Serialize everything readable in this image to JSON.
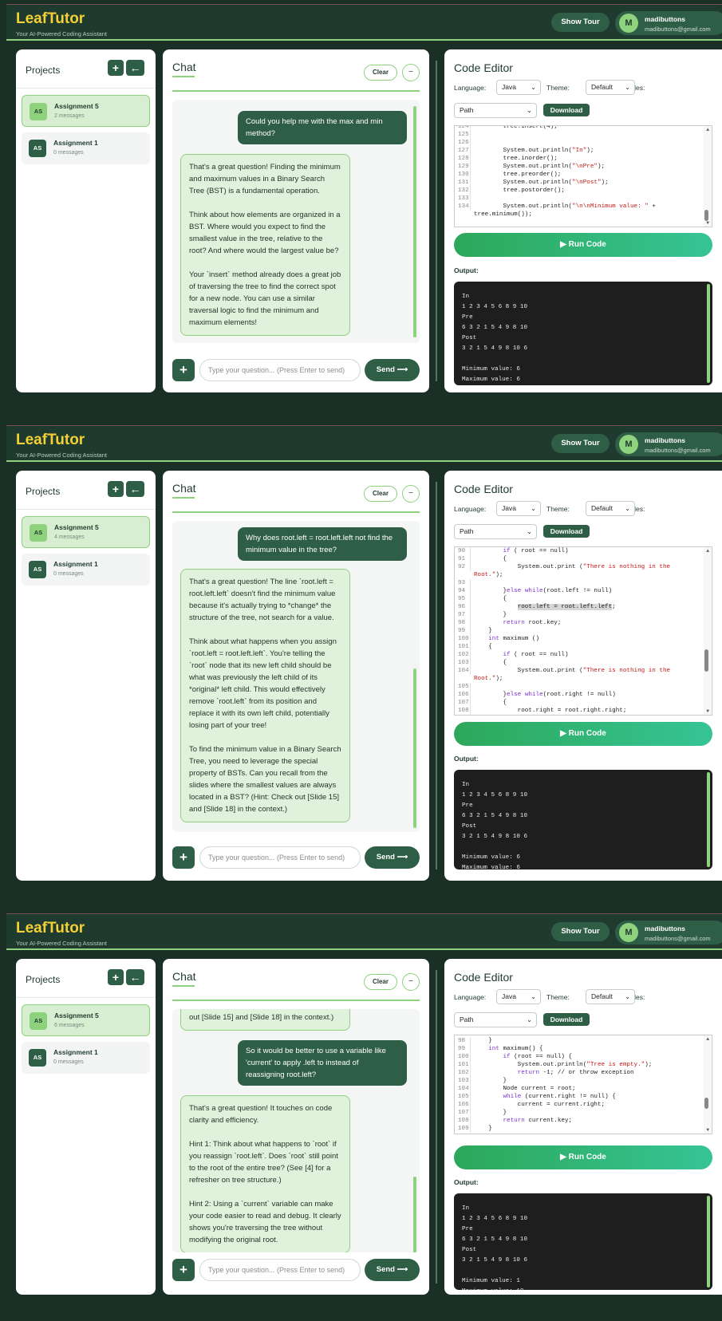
{
  "app": {
    "title": "LeafTutor",
    "tagline": "Your AI-Powered Coding Assistant",
    "show_tour": "Show Tour",
    "user_initial": "M",
    "user_name": "madibuttons",
    "user_email": "madibuttons@gmail.com"
  },
  "labels": {
    "projects": "Projects",
    "add": "+",
    "back": "←",
    "chat": "Chat",
    "clear": "Clear",
    "minimize": "−",
    "input_placeholder": "Type your question... (Press Enter to send)",
    "send": "Send ⟶",
    "code_editor": "Code Editor",
    "language_label": "Language:",
    "theme_label": "Theme:",
    "files_label": "Files:",
    "language": "Java",
    "theme": "Default",
    "path": "Path",
    "download": "Download",
    "run": "▶ Run Code",
    "output": "Output:"
  },
  "colors": {
    "accent": "#8fd27d",
    "dark": "#2f5e47",
    "brand": "#f4cf36",
    "bg": "#1a2f26"
  },
  "screens": [
    {
      "projects": [
        {
          "initials": "AS",
          "name": "Assignment 5",
          "count": "2 messages",
          "active": true
        },
        {
          "initials": "AS",
          "name": "Assignment 1",
          "count": "0 messages",
          "active": false
        }
      ],
      "messages": [
        {
          "role": "user",
          "text": "Could you help me with the max and min method?"
        },
        {
          "role": "ai",
          "text": "That's a great question! Finding the minimum and maximum values in a Binary Search Tree (BST) is a fundamental operation.\n\nThink about how elements are organized in a BST. Where would you expect to find the smallest value in the tree, relative to the root? And where would the largest value be?\n\nYour `insert` method already does a great job of traversing the tree to find the correct spot for a new node. You can use a similar traversal logic to find the minimum and maximum elements!"
        }
      ],
      "code": [
        {
          "n": "124",
          "t": [
            [
              "        tree.insert(4);",
              ""
            ]
          ]
        },
        {
          "n": "125",
          "t": []
        },
        {
          "n": "126",
          "t": []
        },
        {
          "n": "127",
          "t": [
            [
              "        System.out.println(",
              ""
            ],
            [
              "\"In\"",
              "str"
            ],
            [
              ");",
              ""
            ]
          ]
        },
        {
          "n": "128",
          "t": [
            [
              "        tree.inorder();",
              ""
            ]
          ]
        },
        {
          "n": "129",
          "t": [
            [
              "        System.out.println(",
              ""
            ],
            [
              "\"\\nPre\"",
              "str"
            ],
            [
              ");",
              ""
            ]
          ]
        },
        {
          "n": "130",
          "t": [
            [
              "        tree.preorder();",
              ""
            ]
          ]
        },
        {
          "n": "131",
          "t": [
            [
              "        System.out.println(",
              ""
            ],
            [
              "\"\\nPost\"",
              "str"
            ],
            [
              ");",
              ""
            ]
          ]
        },
        {
          "n": "132",
          "t": [
            [
              "        tree.postorder();",
              ""
            ]
          ]
        },
        {
          "n": "133",
          "t": []
        },
        {
          "n": "134",
          "t": [
            [
              "        System.out.println(",
              ""
            ],
            [
              "\"\\n\\nMinimum value: \"",
              "str"
            ],
            [
              " +",
              ""
            ]
          ]
        },
        {
          "n": "",
          "t": [
            [
              "tree.minimum());",
              ""
            ]
          ]
        }
      ],
      "output": [
        "In",
        "1 2 3 4 5 6 8 9 10",
        "Pre",
        "6 3 2 1 5 4 9 8 10",
        "Post",
        "3 2 1 5 4 9 8 10 6",
        "",
        "Minimum value: 6",
        "Maximum value: 6"
      ]
    },
    {
      "projects": [
        {
          "initials": "AS",
          "name": "Assignment 5",
          "count": "4 messages",
          "active": true
        },
        {
          "initials": "AS",
          "name": "Assignment 1",
          "count": "0 messages",
          "active": false
        }
      ],
      "messages": [
        {
          "role": "user",
          "text": "Why does root.left = root.left.left not find the minimum value in the tree?"
        },
        {
          "role": "ai",
          "text": "That's a great question! The line `root.left = root.left.left` doesn't find the minimum value because it's actually trying to *change* the structure of the tree, not search for a value.\n\nThink about what happens when you assign `root.left = root.left.left`. You're telling the `root` node that its new left child should be what was previously the left child of its *original* left child. This would effectively remove `root.left` from its position and replace it with its own left child, potentially losing part of your tree!\n\nTo find the minimum value in a Binary Search Tree, you need to leverage the special property of BSTs. Can you recall from the slides where the smallest values are always located in a BST? (Hint: Check out [Slide 15] and [Slide 18] in the context.)"
        }
      ],
      "code": [
        {
          "n": "90",
          "t": [
            [
              "        ",
              ""
            ],
            [
              "if",
              "kw"
            ],
            [
              " ( root == null)",
              ""
            ]
          ]
        },
        {
          "n": "91",
          "t": [
            [
              "        {",
              ""
            ]
          ]
        },
        {
          "n": "92",
          "t": [
            [
              "            System.out.print (",
              ""
            ],
            [
              "\"There is nothing in the",
              "str"
            ]
          ]
        },
        {
          "n": "",
          "t": [
            [
              "Root.\"",
              "str"
            ],
            [
              ");",
              ""
            ]
          ]
        },
        {
          "n": "93",
          "t": []
        },
        {
          "n": "94",
          "t": [
            [
              "        }",
              ""
            ],
            [
              "else",
              "kw"
            ],
            [
              " ",
              ""
            ],
            [
              "while",
              "kw"
            ],
            [
              "(root.left != null)",
              ""
            ]
          ]
        },
        {
          "n": "95",
          "t": [
            [
              "        {",
              ""
            ]
          ]
        },
        {
          "n": "96",
          "t": [
            [
              "            ",
              ""
            ],
            [
              "root.left = root.left.left",
              "hl"
            ],
            [
              ";",
              ""
            ]
          ]
        },
        {
          "n": "97",
          "t": [
            [
              "        }",
              ""
            ]
          ]
        },
        {
          "n": "98",
          "t": [
            [
              "        ",
              ""
            ],
            [
              "return",
              "kw"
            ],
            [
              " root.key;",
              ""
            ]
          ]
        },
        {
          "n": "99",
          "t": [
            [
              "    }",
              ""
            ]
          ]
        },
        {
          "n": "100",
          "t": [
            [
              "    ",
              ""
            ],
            [
              "int",
              "kw"
            ],
            [
              " maximum ()",
              ""
            ]
          ]
        },
        {
          "n": "101",
          "t": [
            [
              "    {",
              ""
            ]
          ]
        },
        {
          "n": "102",
          "t": [
            [
              "        ",
              ""
            ],
            [
              "if",
              "kw"
            ],
            [
              " ( root == null)",
              ""
            ]
          ]
        },
        {
          "n": "103",
          "t": [
            [
              "        {",
              ""
            ]
          ]
        },
        {
          "n": "104",
          "t": [
            [
              "            System.out.print (",
              ""
            ],
            [
              "\"There is nothing in the",
              "str"
            ]
          ]
        },
        {
          "n": "",
          "t": [
            [
              "Root.\"",
              "str"
            ],
            [
              ");",
              ""
            ]
          ]
        },
        {
          "n": "105",
          "t": []
        },
        {
          "n": "106",
          "t": [
            [
              "        }",
              ""
            ],
            [
              "else",
              "kw"
            ],
            [
              " ",
              ""
            ],
            [
              "while",
              "kw"
            ],
            [
              "(root.right != null)",
              ""
            ]
          ]
        },
        {
          "n": "107",
          "t": [
            [
              "        {",
              ""
            ]
          ]
        },
        {
          "n": "108",
          "t": [
            [
              "            root.right = root.right.right;",
              ""
            ]
          ]
        }
      ],
      "output": [
        "In",
        "1 2 3 4 5 6 8 9 10",
        "Pre",
        "6 3 2 1 5 4 9 8 10",
        "Post",
        "3 2 1 5 4 9 8 10 6",
        "",
        "Minimum value: 6",
        "Maximum value: 6"
      ]
    },
    {
      "projects": [
        {
          "initials": "AS",
          "name": "Assignment 5",
          "count": "6 messages",
          "active": true
        },
        {
          "initials": "AS",
          "name": "Assignment 1",
          "count": "0 messages",
          "active": false
        }
      ],
      "messages": [
        {
          "role": "ai",
          "text": "out [Slide 15] and [Slide 18] in the context.)"
        },
        {
          "role": "user",
          "text": "So it would be better to use a variable like 'current' to apply .left to instead of reassigning root.left?"
        },
        {
          "role": "ai",
          "text": "That's a great question! It touches on code clarity and efficiency.\n\nHint 1: Think about what happens to `root` if you reassign `root.left`. Does `root` still point to the root of the entire tree? (See [4] for a refresher on tree structure.)\n\nHint 2: Using a `current` variable can make your code easier to read and debug. It clearly shows you're traversing the tree without modifying the original root."
        }
      ],
      "code": [
        {
          "n": "98",
          "t": [
            [
              "    }",
              ""
            ]
          ]
        },
        {
          "n": "99",
          "t": [
            [
              "    ",
              ""
            ],
            [
              "int",
              "kw"
            ],
            [
              " maximum() {",
              ""
            ]
          ]
        },
        {
          "n": "100",
          "t": [
            [
              "        ",
              ""
            ],
            [
              "if",
              "kw"
            ],
            [
              " (root == null) {",
              ""
            ]
          ]
        },
        {
          "n": "101",
          "t": [
            [
              "            System.out.println(",
              ""
            ],
            [
              "\"Tree is empty.\"",
              "str"
            ],
            [
              ");",
              ""
            ]
          ]
        },
        {
          "n": "102",
          "t": [
            [
              "            ",
              ""
            ],
            [
              "return",
              "kw"
            ],
            [
              " -1; // or throw exception",
              ""
            ]
          ]
        },
        {
          "n": "103",
          "t": [
            [
              "        }",
              ""
            ]
          ]
        },
        {
          "n": "104",
          "t": [
            [
              "        Node current = root;",
              ""
            ]
          ]
        },
        {
          "n": "105",
          "t": [
            [
              "        ",
              ""
            ],
            [
              "while",
              "kw"
            ],
            [
              " (current.right != null) {",
              ""
            ]
          ]
        },
        {
          "n": "106",
          "t": [
            [
              "            current = current.right;",
              ""
            ]
          ]
        },
        {
          "n": "107",
          "t": [
            [
              "        }",
              ""
            ]
          ]
        },
        {
          "n": "108",
          "t": [
            [
              "        ",
              ""
            ],
            [
              "return",
              "kw"
            ],
            [
              " current.key;",
              ""
            ]
          ]
        },
        {
          "n": "109",
          "t": [
            [
              "    }",
              ""
            ]
          ]
        }
      ],
      "output": [
        "In",
        "1 2 3 4 5 6 8 9 10",
        "Pre",
        "6 3 2 1 5 4 9 8 10",
        "Post",
        "3 2 1 5 4 9 8 10 6",
        "",
        "Minimum value: 1",
        "Maximum value: 10"
      ]
    }
  ]
}
